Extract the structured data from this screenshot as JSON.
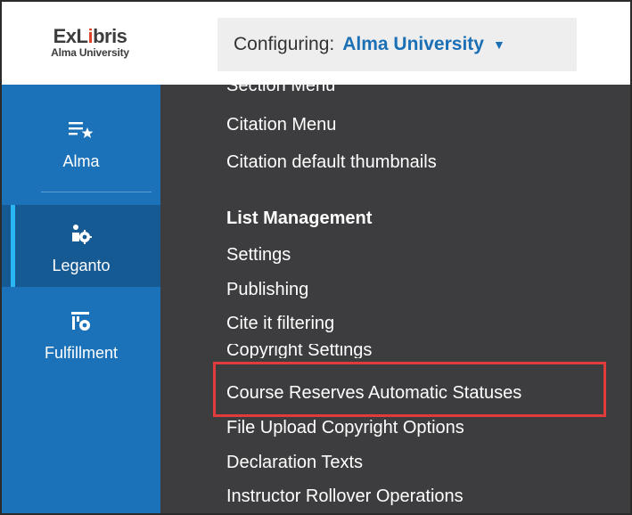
{
  "header": {
    "logo": {
      "brand_prefix": "ExL",
      "brand_mark": "i",
      "brand_suffix": "bris",
      "subtitle": "Alma University"
    },
    "configuring_label": "Configuring:",
    "configuring_value": "Alma University",
    "caret": "▼"
  },
  "sidebar": {
    "items": [
      {
        "label": "Alma",
        "icon": "alma-list-star-icon",
        "active": false
      },
      {
        "label": "Leganto",
        "icon": "leganto-gear-icon",
        "active": true
      },
      {
        "label": "Fulfillment",
        "icon": "fulfillment-gear-icon",
        "active": false
      }
    ]
  },
  "menu": {
    "items": [
      {
        "label": "Section Menu",
        "type": "link"
      },
      {
        "label": "Citation Menu",
        "type": "link"
      },
      {
        "label": "Citation default thumbnails",
        "type": "link"
      },
      {
        "label": "List Management",
        "type": "heading"
      },
      {
        "label": "Settings",
        "type": "link"
      },
      {
        "label": "Publishing",
        "type": "link"
      },
      {
        "label": "Cite it filtering",
        "type": "link"
      },
      {
        "label": "Copyright Settings",
        "type": "link"
      },
      {
        "label": "Course Reserves Automatic Statuses",
        "type": "link",
        "highlighted": true
      },
      {
        "label": "File Upload Copyright Options",
        "type": "link"
      },
      {
        "label": "Declaration Texts",
        "type": "link"
      },
      {
        "label": "Instructor Rollover Operations",
        "type": "link"
      }
    ]
  },
  "colors": {
    "sidebar_bg": "#1c72b8",
    "sidebar_active_bg": "#165a94",
    "sidebar_accent": "#28b7f2",
    "menu_bg": "#3d3d3f",
    "link_blue": "#1a6fb5",
    "highlight_red": "#e23b3b"
  }
}
